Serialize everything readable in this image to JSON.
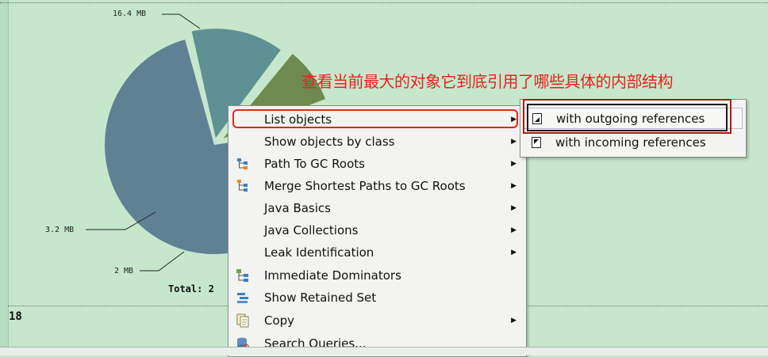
{
  "chart_data": {
    "type": "pie",
    "slices": [
      {
        "label": "16.4 MB",
        "value": 16.4,
        "color": "#5f8194"
      },
      {
        "label": "3.2 MB",
        "value": 3.2,
        "color": "#5f9093"
      },
      {
        "label": "2 MB",
        "value": 2.0,
        "color": "#6f8a4f"
      },
      {
        "label": "",
        "value": 0.6,
        "color": "#d9ddd9"
      }
    ],
    "total_label": "Total: 2"
  },
  "status_fragment": "18",
  "annotation_text": "查看当前最大的对象它到底引用了哪些具体的内部结构",
  "context_menu": {
    "items": [
      {
        "label": "List objects",
        "submenu": true,
        "icon": "none"
      },
      {
        "label": "Show objects by class",
        "submenu": true,
        "icon": "none"
      },
      {
        "label": "Path To GC Roots",
        "submenu": true,
        "icon": "path-tree-icon"
      },
      {
        "label": "Merge Shortest Paths to GC Roots",
        "submenu": true,
        "icon": "merge-paths-icon"
      },
      {
        "label": "Java Basics",
        "submenu": true,
        "icon": "none"
      },
      {
        "label": "Java Collections",
        "submenu": true,
        "icon": "none"
      },
      {
        "label": "Leak Identification",
        "submenu": true,
        "icon": "none"
      },
      {
        "label": "Immediate Dominators",
        "submenu": false,
        "icon": "dominator-tree-icon"
      },
      {
        "label": "Show Retained Set",
        "submenu": false,
        "icon": "retained-set-icon"
      },
      {
        "label": "Copy",
        "submenu": true,
        "icon": "copy-icon"
      },
      {
        "label": "Search Queries...",
        "submenu": false,
        "icon": "search-db-icon"
      }
    ],
    "arrow": "▶"
  },
  "submenu": {
    "items": [
      {
        "label": "with outgoing references",
        "icon": "outgoing-ref-icon",
        "selected": true
      },
      {
        "label": "with incoming references",
        "icon": "incoming-ref-icon",
        "selected": false
      }
    ]
  }
}
